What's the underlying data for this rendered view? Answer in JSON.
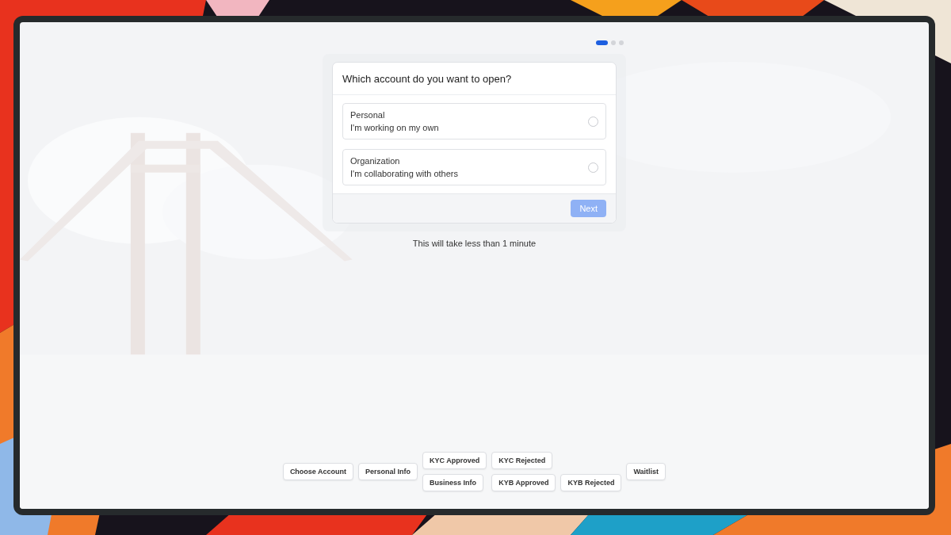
{
  "steps": [
    {
      "selected": true
    },
    {
      "selected": false
    },
    {
      "selected": false
    }
  ],
  "card": {
    "title": "Which account do you want to open?",
    "options": [
      {
        "title": "Personal",
        "subtitle": "I'm working on my own",
        "selected": false
      },
      {
        "title": "Organization",
        "subtitle": "I'm collaborating with others",
        "selected": false
      }
    ],
    "next_button": {
      "label": "Next",
      "disabled": true
    }
  },
  "note": "This will take less than 1 minute",
  "debug_buttons": [
    "Choose Account",
    "Personal Info",
    "KYC Approved",
    "KYC Rejected",
    "Business Info",
    "KYB Approved",
    "KYB Rejected",
    "Waitlist"
  ]
}
